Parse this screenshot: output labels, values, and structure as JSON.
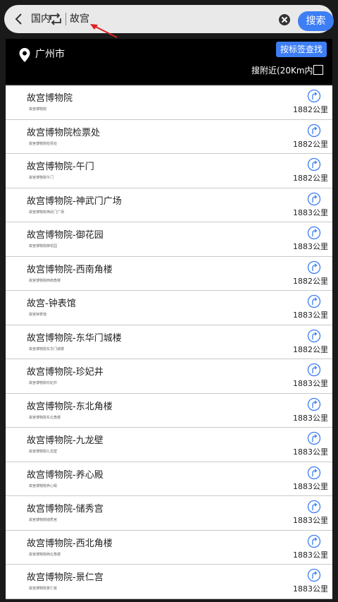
{
  "topbar": {
    "region": "国内",
    "query": "故宫",
    "search_label": "搜索",
    "icons": [
      "back-icon",
      "swap-icon",
      "clear-icon",
      "annotation-arrow"
    ]
  },
  "location": {
    "city": "广州市",
    "tag_search_label": "按标签查找",
    "nearby_label": "搜附近(20Km内)",
    "nearby_checked": false
  },
  "colors": {
    "accent": "#3d7ef5",
    "panel": "#000000",
    "annotation": "#e02020"
  },
  "results": [
    {
      "name": "故宫博物院",
      "sub": "故宫博物院",
      "dist": "1882公里"
    },
    {
      "name": "故宫博物院检票处",
      "sub": "故宫博物院检票处",
      "dist": "1882公里"
    },
    {
      "name": "故宫博物院-午门",
      "sub": "故宫博物院午门",
      "dist": "1882公里"
    },
    {
      "name": "故宫博物院-神武门广场",
      "sub": "故宫博物院神武门广场",
      "dist": "1883公里"
    },
    {
      "name": "故宫博物院-御花园",
      "sub": "故宫博物院御花园",
      "dist": "1883公里"
    },
    {
      "name": "故宫博物院-西南角楼",
      "sub": "故宫博物院西南角楼",
      "dist": "1882公里"
    },
    {
      "name": "故宫-钟表馆",
      "sub": "故宫钟表馆",
      "dist": "1883公里"
    },
    {
      "name": "故宫博物院-东华门城楼",
      "sub": "故宫博物院东华门城楼",
      "dist": "1882公里"
    },
    {
      "name": "故宫博物院-珍妃井",
      "sub": "故宫博物院珍妃井",
      "dist": "1883公里"
    },
    {
      "name": "故宫博物院-东北角楼",
      "sub": "故宫博物院东北角楼",
      "dist": "1883公里"
    },
    {
      "name": "故宫博物院-九龙壁",
      "sub": "故宫博物院九龙壁",
      "dist": "1883公里"
    },
    {
      "name": "故宫博物院-养心殿",
      "sub": "故宫博物院养心殿",
      "dist": "1883公里"
    },
    {
      "name": "故宫博物院-储秀宫",
      "sub": "故宫博物院储秀宫",
      "dist": "1883公里"
    },
    {
      "name": "故宫博物院-西北角楼",
      "sub": "故宫博物院西北角楼",
      "dist": "1883公里"
    },
    {
      "name": "故宫博物院-景仁宫",
      "sub": "故宫博物院景仁宫",
      "dist": "1883公里"
    }
  ]
}
